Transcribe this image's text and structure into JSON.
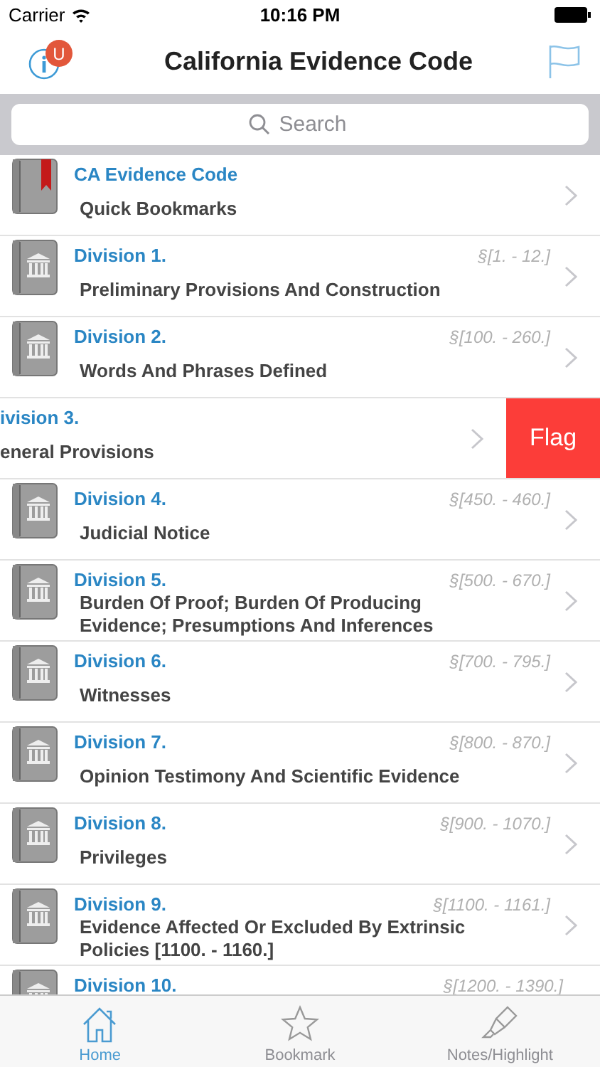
{
  "status_bar": {
    "carrier": "Carrier",
    "time": "10:16 PM"
  },
  "nav": {
    "title": "California Evidence Code",
    "badge": "U"
  },
  "search": {
    "placeholder": "Search"
  },
  "rows": [
    {
      "kind": "bookmark",
      "title": "CA Evidence Code",
      "subtitle": "Quick Bookmarks"
    },
    {
      "kind": "division",
      "title": "Division 1.",
      "range": "§[1. - 12.]",
      "subtitle": "Preliminary Provisions And Construction"
    },
    {
      "kind": "division",
      "title": "Division 2.",
      "range": "§[100. - 260.]",
      "subtitle": "Words And Phrases Defined"
    },
    {
      "kind": "swiped",
      "title": "ivision 3.",
      "subtitle": "eneral Provisions",
      "action": "Flag"
    },
    {
      "kind": "division",
      "title": "Division 4.",
      "range": "§[450. - 460.]",
      "subtitle": "Judicial Notice"
    },
    {
      "kind": "division",
      "title": "Division 5.",
      "range": "§[500. - 670.]",
      "subtitle": "Burden Of Proof; Burden Of Producing Evidence; Presumptions And Inferences"
    },
    {
      "kind": "division",
      "title": "Division 6.",
      "range": "§[700. - 795.]",
      "subtitle": "Witnesses"
    },
    {
      "kind": "division",
      "title": "Division 7.",
      "range": "§[800. - 870.]",
      "subtitle": "Opinion Testimony And Scientific Evidence"
    },
    {
      "kind": "division",
      "title": "Division 8.",
      "range": "§[900. - 1070.]",
      "subtitle": "Privileges"
    },
    {
      "kind": "division",
      "title": "Division 9.",
      "range": "§[1100. - 1161.]",
      "subtitle": "Evidence Affected Or Excluded By Extrinsic Policies [1100. - 1160.]"
    },
    {
      "kind": "division",
      "title": "Division 10.",
      "range": "§[1200. - 1390.]"
    }
  ],
  "tabs": [
    {
      "kind": "home",
      "label": "Home",
      "selected": true
    },
    {
      "kind": "star",
      "label": "Bookmark",
      "selected": false
    },
    {
      "kind": "highlighter",
      "label": "Notes/Highlight",
      "selected": false
    }
  ]
}
